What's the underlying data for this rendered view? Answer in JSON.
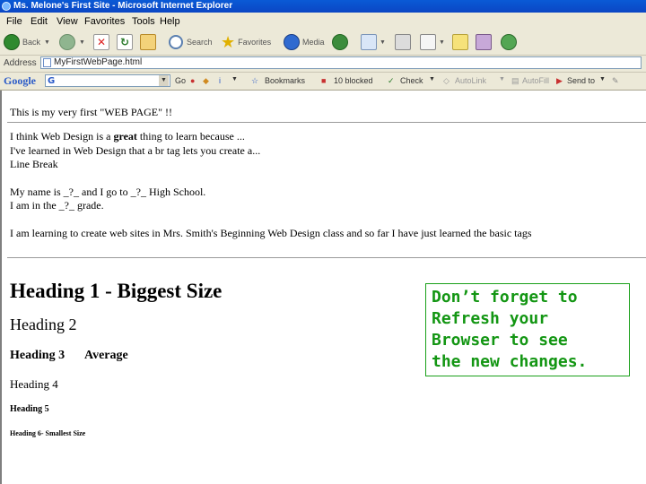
{
  "window": {
    "title": "Ms. Melone's First Site - Microsoft Internet Explorer"
  },
  "menu": [
    "File",
    "Edit",
    "View",
    "Favorites",
    "Tools",
    "Help"
  ],
  "toolbar": {
    "back": "Back",
    "search": "Search",
    "favorites": "Favorites",
    "media": "Media"
  },
  "address": {
    "label": "Address",
    "value": "MyFirstWebPage.html"
  },
  "googlebar": {
    "logo": "Google",
    "go": "Go",
    "bookmarks": "Bookmarks",
    "blocked": "10 blocked",
    "check": "Check",
    "autolink": "AutoLink",
    "autofill": "AutoFill",
    "sendto": "Send to"
  },
  "page": {
    "line1": "This is my very first \"WEB PAGE\" !!",
    "line2_a": "I think Web Design is a",
    "line2_bold": "great",
    "line2_b": "thing to learn because ...",
    "line3": "I've learned in Web Design that a br tag lets you create a...",
    "line4": "Line Break",
    "line5": "My name is  _?_  and I go to  _?_  High School.",
    "line6": "I am in the _?_ grade.",
    "line7": "I am learning to create web sites in Mrs. Smith's Beginning Web Design class and so far I have just learned the basic tags",
    "h1": "Heading 1 - Biggest Size",
    "h2": "Heading 2",
    "h3": "Heading 3",
    "h3_extra": "Average",
    "h4": "Heading 4",
    "h5": "Heading 5",
    "h6": "Heading 6- Smallest Size"
  },
  "note": {
    "lines": [
      "Don’t forget to",
      "Refresh your",
      "Browser to see",
      "the new changes."
    ],
    "color": "#139613"
  },
  "colors": {
    "titlebar": "#0b46c4",
    "chrome": "#ece9d8"
  }
}
